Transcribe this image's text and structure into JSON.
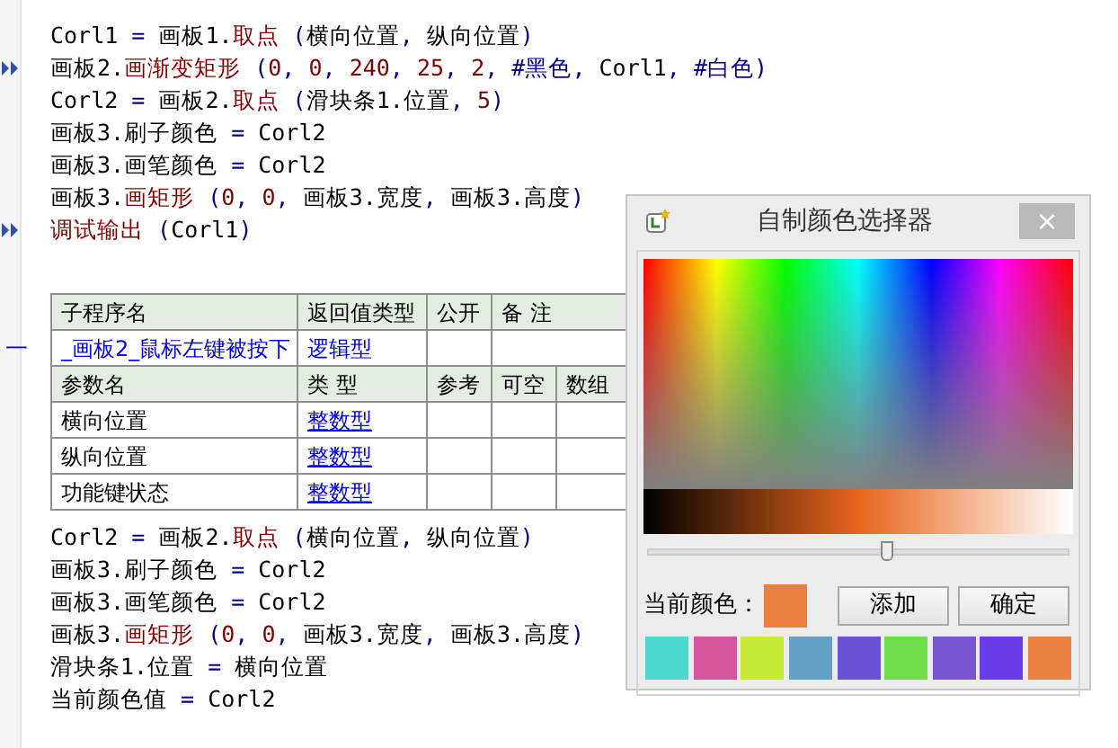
{
  "code_top": [
    {
      "marker": false,
      "parts": [
        {
          "kind": "text",
          "text": "Corl1 "
        },
        {
          "kind": "op",
          "text": "="
        },
        {
          "kind": "text",
          "text": " 画板1."
        },
        {
          "kind": "method",
          "text": "取点"
        },
        {
          "kind": "op",
          "text": " ("
        },
        {
          "kind": "text",
          "text": "横向位置"
        },
        {
          "kind": "op",
          "text": ", "
        },
        {
          "kind": "text",
          "text": "纵向位置"
        },
        {
          "kind": "op",
          "text": ")"
        }
      ]
    },
    {
      "marker": true,
      "parts": [
        {
          "kind": "text",
          "text": "画板2."
        },
        {
          "kind": "method",
          "text": "画渐变矩形"
        },
        {
          "kind": "op",
          "text": " ("
        },
        {
          "kind": "number",
          "text": "0"
        },
        {
          "kind": "op",
          "text": ", "
        },
        {
          "kind": "number",
          "text": "0"
        },
        {
          "kind": "op",
          "text": ", "
        },
        {
          "kind": "number",
          "text": "240"
        },
        {
          "kind": "op",
          "text": ", "
        },
        {
          "kind": "number",
          "text": "25"
        },
        {
          "kind": "op",
          "text": ", "
        },
        {
          "kind": "number",
          "text": "2"
        },
        {
          "kind": "op",
          "text": ", "
        },
        {
          "kind": "const",
          "text": "#黑色"
        },
        {
          "kind": "op",
          "text": ", "
        },
        {
          "kind": "text",
          "text": "Corl1"
        },
        {
          "kind": "op",
          "text": ", "
        },
        {
          "kind": "const",
          "text": "#白色"
        },
        {
          "kind": "op",
          "text": ")"
        }
      ]
    },
    {
      "marker": false,
      "parts": [
        {
          "kind": "text",
          "text": "Corl2 "
        },
        {
          "kind": "op",
          "text": "="
        },
        {
          "kind": "text",
          "text": " 画板2."
        },
        {
          "kind": "method",
          "text": "取点"
        },
        {
          "kind": "op",
          "text": " ("
        },
        {
          "kind": "text",
          "text": "滑块条1.位置"
        },
        {
          "kind": "op",
          "text": ", "
        },
        {
          "kind": "number",
          "text": "5"
        },
        {
          "kind": "op",
          "text": ")"
        }
      ]
    },
    {
      "marker": false,
      "parts": [
        {
          "kind": "text",
          "text": "画板3.刷子颜色 "
        },
        {
          "kind": "op",
          "text": "="
        },
        {
          "kind": "text",
          "text": " Corl2"
        }
      ]
    },
    {
      "marker": false,
      "parts": [
        {
          "kind": "text",
          "text": "画板3.画笔颜色 "
        },
        {
          "kind": "op",
          "text": "="
        },
        {
          "kind": "text",
          "text": " Corl2"
        }
      ]
    },
    {
      "marker": false,
      "parts": [
        {
          "kind": "text",
          "text": "画板3."
        },
        {
          "kind": "method",
          "text": "画矩形"
        },
        {
          "kind": "op",
          "text": " ("
        },
        {
          "kind": "number",
          "text": "0"
        },
        {
          "kind": "op",
          "text": ", "
        },
        {
          "kind": "number",
          "text": "0"
        },
        {
          "kind": "op",
          "text": ", "
        },
        {
          "kind": "text",
          "text": "画板3.宽度"
        },
        {
          "kind": "op",
          "text": ", "
        },
        {
          "kind": "text",
          "text": "画板3.高度"
        },
        {
          "kind": "op",
          "text": ")"
        }
      ]
    },
    {
      "marker": true,
      "parts": [
        {
          "kind": "method",
          "text": "调试输出"
        },
        {
          "kind": "op",
          "text": " ("
        },
        {
          "kind": "text",
          "text": "Corl1"
        },
        {
          "kind": "op",
          "text": ")"
        }
      ]
    }
  ],
  "subroutine": {
    "collapse": "一",
    "columns": [
      "子程序名",
      "返回值类型",
      "公开",
      "备 注"
    ],
    "name": "_画板2_鼠标左键被按下",
    "return_type": "逻辑型",
    "param_columns": [
      "参数名",
      "类 型",
      "参考",
      "可空",
      "数组"
    ],
    "params": [
      {
        "name": "横向位置",
        "type": "整数型"
      },
      {
        "name": "纵向位置",
        "type": "整数型"
      },
      {
        "name": "功能键状态",
        "type": "整数型"
      }
    ]
  },
  "code_bottom": [
    {
      "marker": false,
      "parts": [
        {
          "kind": "text",
          "text": "Corl2 "
        },
        {
          "kind": "op",
          "text": "="
        },
        {
          "kind": "text",
          "text": " 画板2."
        },
        {
          "kind": "method",
          "text": "取点"
        },
        {
          "kind": "op",
          "text": " ("
        },
        {
          "kind": "text",
          "text": "横向位置"
        },
        {
          "kind": "op",
          "text": ", "
        },
        {
          "kind": "text",
          "text": "纵向位置"
        },
        {
          "kind": "op",
          "text": ")"
        }
      ]
    },
    {
      "marker": false,
      "parts": [
        {
          "kind": "text",
          "text": "画板3.刷子颜色 "
        },
        {
          "kind": "op",
          "text": "="
        },
        {
          "kind": "text",
          "text": " Corl2"
        }
      ]
    },
    {
      "marker": false,
      "parts": [
        {
          "kind": "text",
          "text": "画板3.画笔颜色 "
        },
        {
          "kind": "op",
          "text": "="
        },
        {
          "kind": "text",
          "text": " Corl2"
        }
      ]
    },
    {
      "marker": false,
      "parts": [
        {
          "kind": "text",
          "text": "画板3."
        },
        {
          "kind": "method",
          "text": "画矩形"
        },
        {
          "kind": "op",
          "text": " ("
        },
        {
          "kind": "number",
          "text": "0"
        },
        {
          "kind": "op",
          "text": ", "
        },
        {
          "kind": "number",
          "text": "0"
        },
        {
          "kind": "op",
          "text": ", "
        },
        {
          "kind": "text",
          "text": "画板3.宽度"
        },
        {
          "kind": "op",
          "text": ", "
        },
        {
          "kind": "text",
          "text": "画板3.高度"
        },
        {
          "kind": "op",
          "text": ")"
        }
      ]
    },
    {
      "marker": false,
      "parts": [
        {
          "kind": "text",
          "text": "滑块条1.位置 "
        },
        {
          "kind": "op",
          "text": "="
        },
        {
          "kind": "text",
          "text": " 横向位置"
        }
      ]
    },
    {
      "marker": false,
      "parts": [
        {
          "kind": "text",
          "text": "当前颜色值 "
        },
        {
          "kind": "op",
          "text": "="
        },
        {
          "kind": "text",
          "text": " Corl2"
        }
      ]
    }
  ],
  "dialog": {
    "title": "自制颜色选择器",
    "close": "×",
    "slider": {
      "level": 0.57
    },
    "current_label": "当前颜色：",
    "buttons": [
      "添加",
      "确定"
    ],
    "swatches": [
      {
        "color": "#4dd9cf"
      },
      {
        "color": "#d6559c"
      },
      {
        "color": "#c8eb35"
      },
      {
        "color": "#60a0c4"
      },
      {
        "color": "#6a52d2"
      },
      {
        "color": "#6ddc4a"
      },
      {
        "color": "#7a55d2"
      },
      {
        "color": "#6a3be8"
      },
      {
        "color": "#eb7f40"
      }
    ]
  }
}
